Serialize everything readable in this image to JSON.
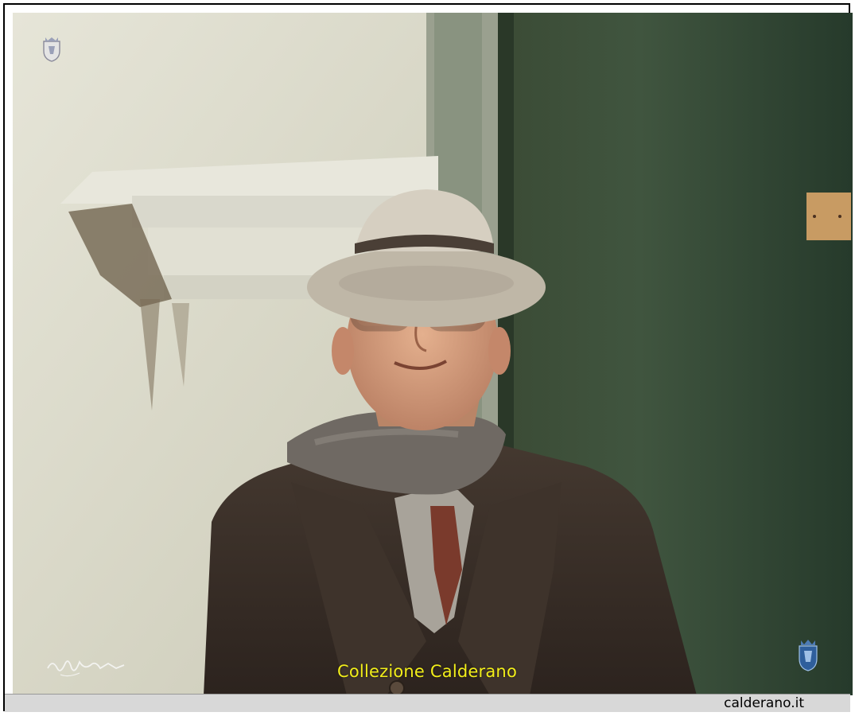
{
  "photo": {
    "subject": "Elderly man in hat, glasses, scarf and wool coat"
  },
  "caption": {
    "text": "Collezione Calderano",
    "color": "#f2ee1a"
  },
  "footer": {
    "site": "calderano.it"
  },
  "colors": {
    "wall": "#dcdbcc",
    "door": "#2e4230",
    "coat": "#3a3029",
    "hat": "#cdc6b7",
    "footer_bg": "#d8d8d8"
  },
  "icons": {
    "crest_top": "crest-icon",
    "crest_bottom": "crest-icon",
    "signature": "signature-mark"
  }
}
